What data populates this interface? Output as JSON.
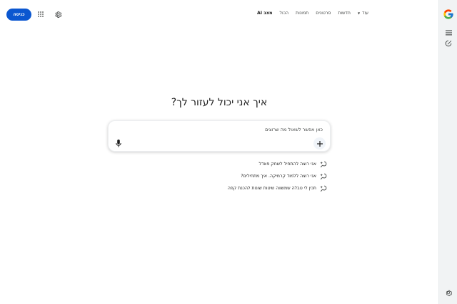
{
  "top_bar": {
    "signin_label": "כניסה",
    "nav_tabs": [
      {
        "label": "מצב AI",
        "active": true
      },
      {
        "label": "הכול"
      },
      {
        "label": "תמונות"
      },
      {
        "label": "סרטונים"
      },
      {
        "label": "חדשות"
      },
      {
        "label": "עוד"
      }
    ]
  },
  "main": {
    "heading": "איך אני יכול לעזור לך?",
    "search": {
      "placeholder": "כאן אפשר לשאול מה שרוצים"
    },
    "suggestions": [
      "אני רוצה להתחיל לשחק פאדל",
      "אני רוצה ללמוד קרמיקה. איך מתחילים?",
      "תכין לי טבלה שמשווה שיטות שונות להכנת קפה"
    ]
  },
  "colors": {
    "accent": "#0b57d0",
    "text": "#1f1f1f",
    "muted": "#444746",
    "rail": "#f1f3f4"
  },
  "icons": [
    "apps-grid-icon",
    "gear-icon",
    "google-g-icon",
    "menu-icon",
    "edit-chat-icon",
    "mic-icon",
    "plus-icon",
    "sparkle-search-icon"
  ]
}
